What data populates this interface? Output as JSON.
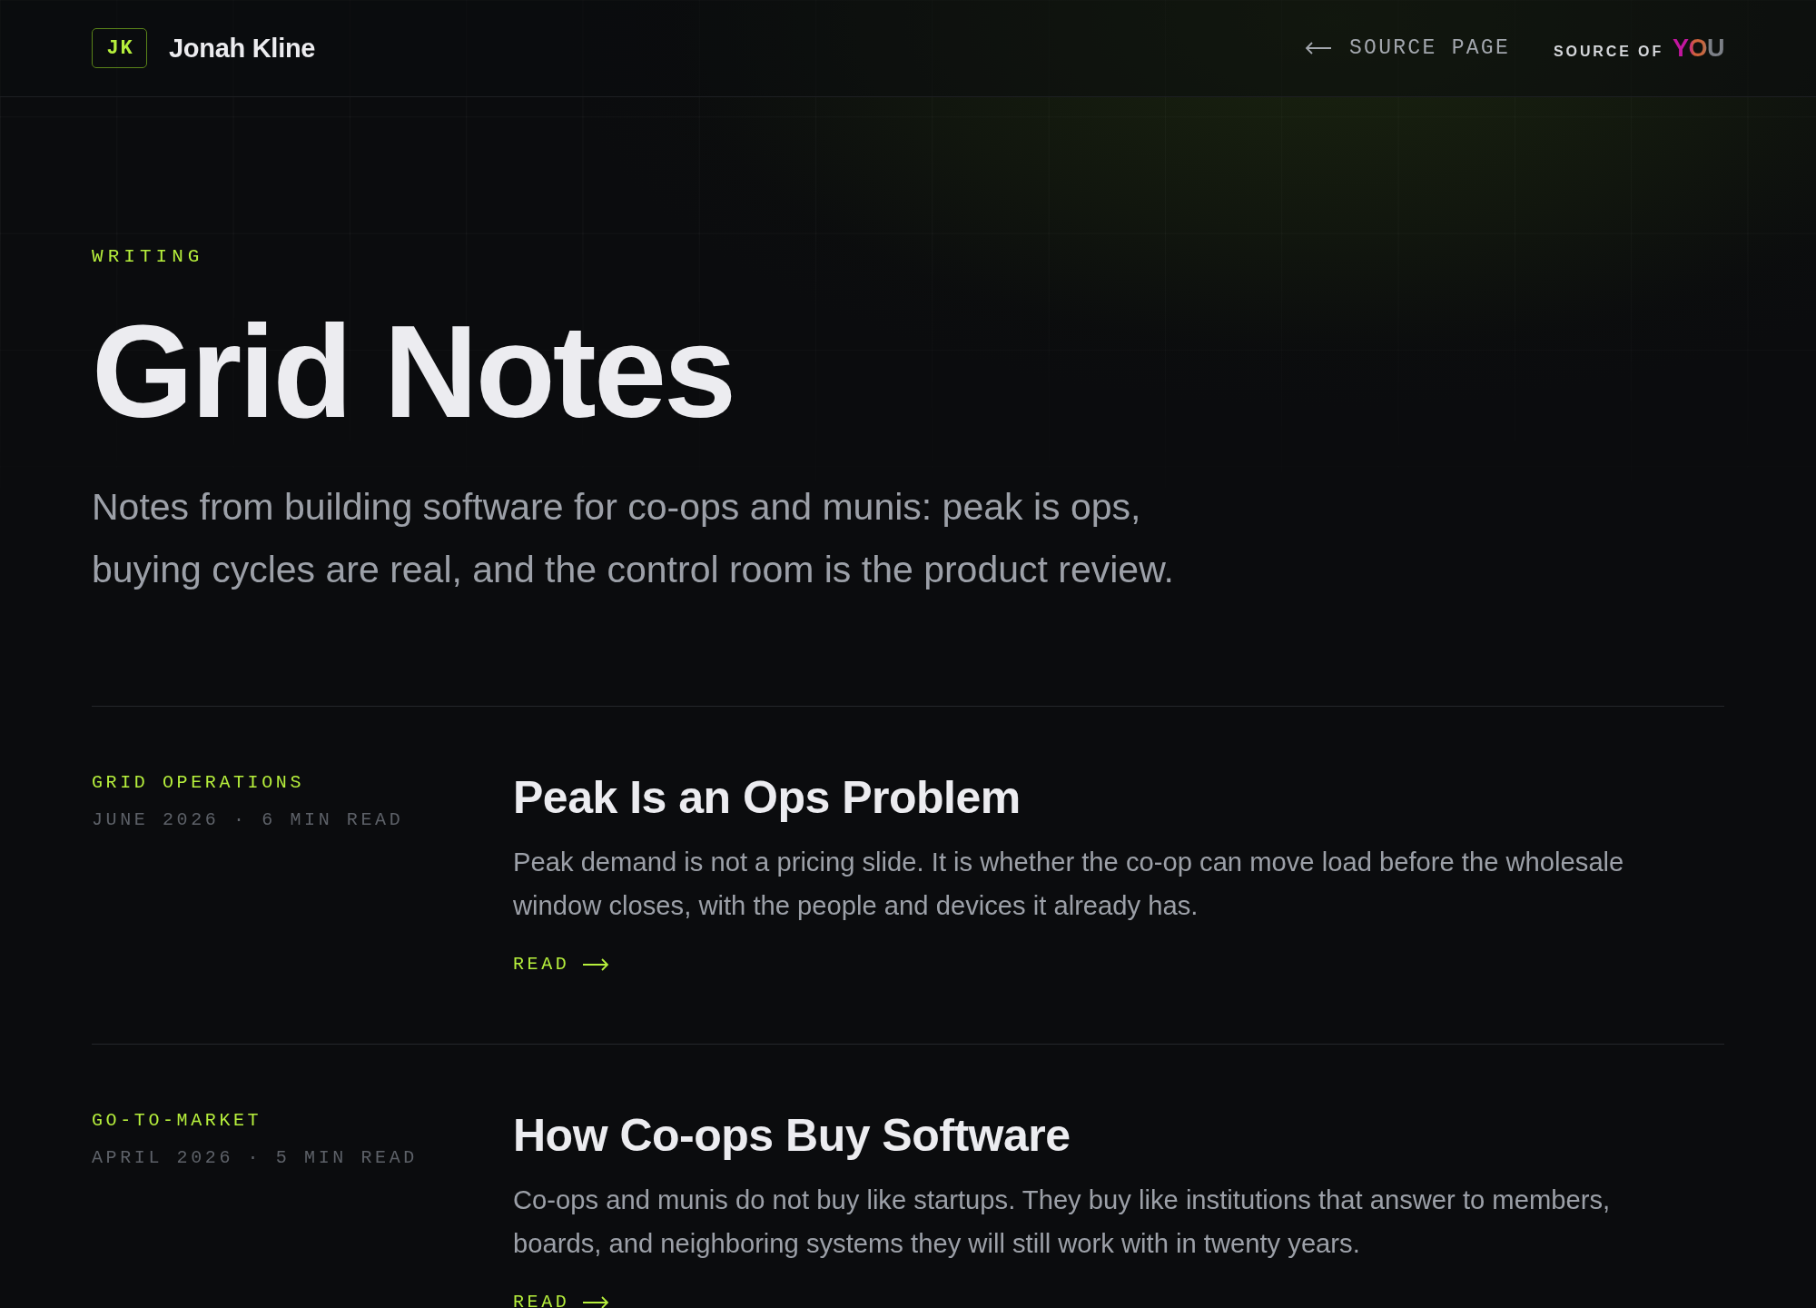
{
  "header": {
    "monogram": "JK",
    "name": "Jonah Kline",
    "back_link": {
      "label": "SOURCE PAGE"
    },
    "brand": {
      "prefix": "SOURCE OF",
      "mark": "YOU"
    }
  },
  "hero": {
    "eyebrow": "WRITING",
    "title": "Grid Notes",
    "description": "Notes from building software for co-ops and munis: peak is ops, buying cycles are real, and the control room is the product review."
  },
  "articles": [
    {
      "category": "GRID OPERATIONS",
      "meta": "JUNE 2026 · 6 MIN READ",
      "title": "Peak Is an Ops Problem",
      "excerpt": "Peak demand is not a pricing slide. It is whether the co-op can move load before the wholesale window closes, with the people and devices it already has.",
      "link": "READ"
    },
    {
      "category": "GO-TO-MARKET",
      "meta": "APRIL 2026 · 5 MIN READ",
      "title": "How Co-ops Buy Software",
      "excerpt": "Co-ops and munis do not buy like startups. They buy like institutions that answer to members, boards, and neighboring systems they will still work with in twenty years.",
      "link": "READ"
    }
  ]
}
